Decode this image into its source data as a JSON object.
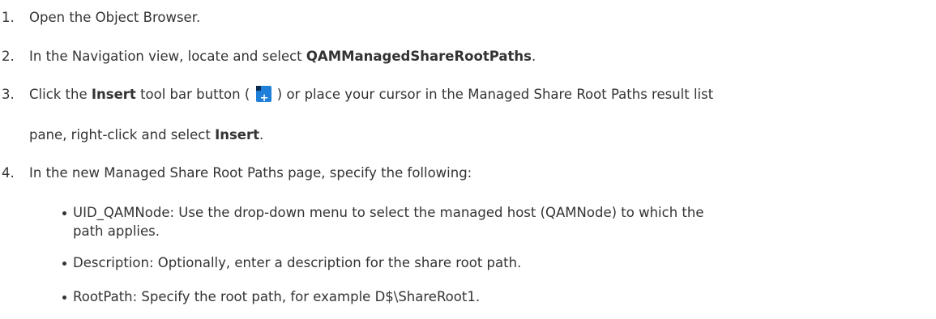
{
  "steps": [
    {
      "num": "1.",
      "text": "Open the Object Browser."
    },
    {
      "num": "2.",
      "pre": "In the Navigation view, locate and select ",
      "bold": "QAMManagedShareRootPaths",
      "post": "."
    },
    {
      "num": "3.",
      "pre": "Click the ",
      "bold": "Insert",
      "mid": " tool bar button ( ",
      "post": " ) or place your cursor in the Managed Share Root Paths result list",
      "cont_pre": "pane, right-click and select ",
      "cont_bold": "Insert",
      "cont_post": "."
    },
    {
      "num": "4.",
      "text": "In the new Managed Share Root Paths page, specify the following:"
    }
  ],
  "bullets": [
    {
      "line1": "UID_QAMNode: Use the drop-down menu to select the managed host (QAMNode) to which the",
      "line2": "path applies."
    },
    {
      "line1": "Description: Optionally, enter a description for the share root path."
    },
    {
      "line1": "RootPath: Specify the root path, for example D$\\ShareRoot1."
    }
  ],
  "icons": {
    "insert": "insert-icon"
  }
}
